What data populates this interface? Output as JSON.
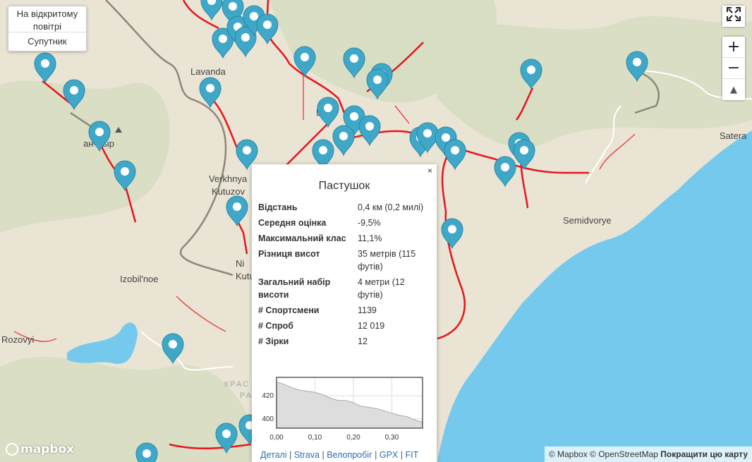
{
  "layers": {
    "outdoor": "На відкритому повітрі",
    "satellite": "Супутник"
  },
  "map_labels": [
    {
      "id": "lavanda",
      "text": "Lavanda"
    },
    {
      "id": "verkhnya",
      "text": "Verkhnya"
    },
    {
      "id": "kutuzova",
      "text": "Kutuzov"
    },
    {
      "id": "nizh",
      "text": "Ni"
    },
    {
      "id": "kutu2",
      "text": "Kutu"
    },
    {
      "id": "izobilnoe",
      "text": "Izobil'noe"
    },
    {
      "id": "rozovyi",
      "text": "Rozovyi"
    },
    {
      "id": "semidvorye",
      "text": "Semidvorye"
    },
    {
      "id": "satera",
      "text": "Satera"
    },
    {
      "id": "khyr",
      "text": "ан-Хыр"
    },
    {
      "id": "lu",
      "text": "Lu"
    },
    {
      "id": "kras",
      "text": "КРАС"
    },
    {
      "id": "ra",
      "text": "РА"
    }
  ],
  "popup": {
    "close": "×",
    "title": "Пастушок",
    "stats": [
      {
        "k": "Відстань",
        "v": "0,4 км (0,2 милі)"
      },
      {
        "k": "Середня оцінка",
        "v": "-9,5%"
      },
      {
        "k": "Максимальний клас",
        "v": "11,1%"
      },
      {
        "k": "Різниця висот",
        "v": "35 метрів (115 футів)"
      },
      {
        "k": "Загальний набір висоти",
        "v": "4 метри (12 футів)"
      },
      {
        "k": "# Спортсмени",
        "v": "1139"
      },
      {
        "k": "# Спроб",
        "v": "12 019"
      },
      {
        "k": "# Зірки",
        "v": "12"
      }
    ],
    "links": [
      "Деталі",
      "Strava",
      "Велопробіг",
      "GPX",
      "FIT"
    ]
  },
  "chart_data": {
    "type": "area",
    "x": [
      0,
      0.02,
      0.04,
      0.06,
      0.08,
      0.1,
      0.12,
      0.14,
      0.16,
      0.18,
      0.2,
      0.22,
      0.24,
      0.26,
      0.28,
      0.3,
      0.32,
      0.34,
      0.36,
      0.38
    ],
    "y": [
      432,
      430,
      427,
      425,
      424,
      423,
      421,
      418,
      416,
      416,
      414,
      411,
      410,
      409,
      407,
      405,
      403,
      402,
      399,
      397
    ],
    "xticks": [
      "0,00",
      "0,10",
      "0,20",
      "0,30"
    ],
    "yticks": [
      "420",
      "400"
    ],
    "xlim": [
      0,
      0.38
    ],
    "ylim": [
      392,
      436
    ]
  },
  "controls": {
    "zoom_in": "+",
    "zoom_out": "−",
    "compass": "▲",
    "fullscreen_icon": "fullscreen-icon"
  },
  "attribution": {
    "mapbox": "© Mapbox",
    "osm": "© OpenStreetMap",
    "improve": "Покращити цю карту"
  },
  "logo": "mapbox",
  "colors": {
    "segment": "#e8141b",
    "marker": "#3fa8c8",
    "sea": "#74c9ec",
    "land": "#e9e4d4"
  }
}
